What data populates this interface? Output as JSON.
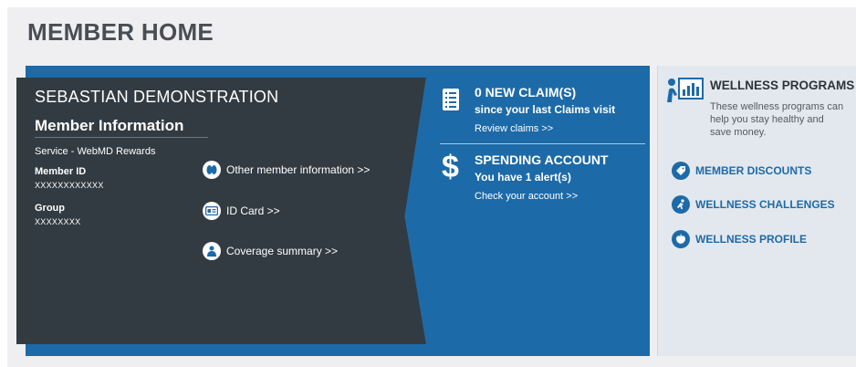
{
  "page": {
    "title": "MEMBER HOME"
  },
  "member": {
    "name": "SEBASTIAN DEMONSTRATION",
    "section_title": "Member Information",
    "service": "Service - WebMD Rewards",
    "id_label": "Member ID",
    "id_value": "XXXXXXXXXXXX",
    "group_label": "Group",
    "group_value": "XXXXXXXX"
  },
  "member_links": [
    {
      "label": "Other member information >>",
      "icon": "people-icon"
    },
    {
      "label": "ID Card >>",
      "icon": "id-card-icon"
    },
    {
      "label": "Coverage summary >>",
      "icon": "coverage-icon"
    }
  ],
  "claims": {
    "title": "0 NEW CLAIM(S)",
    "subtitle": "since your last Claims visit",
    "link": "Review claims >>",
    "icon": "claims-list-icon"
  },
  "spending": {
    "title": "SPENDING ACCOUNT",
    "subtitle": "You have 1 alert(s)",
    "link": "Check your account >>",
    "icon": "dollar-icon"
  },
  "wellness": {
    "title": "WELLNESS PROGRAMS",
    "description": "These wellness programs can help you stay healthy and save money.",
    "icon": "wellness-chart-icon",
    "links": [
      {
        "label": "MEMBER DISCOUNTS",
        "icon": "discount-icon"
      },
      {
        "label": "WELLNESS CHALLENGES",
        "icon": "runner-icon"
      },
      {
        "label": "WELLNESS PROFILE",
        "icon": "apple-icon"
      }
    ]
  },
  "colors": {
    "primary_blue": "#1d6aa8",
    "dark_panel": "#323b42",
    "wellness_bg": "#e3e8ee",
    "page_bg": "#efeff1"
  }
}
